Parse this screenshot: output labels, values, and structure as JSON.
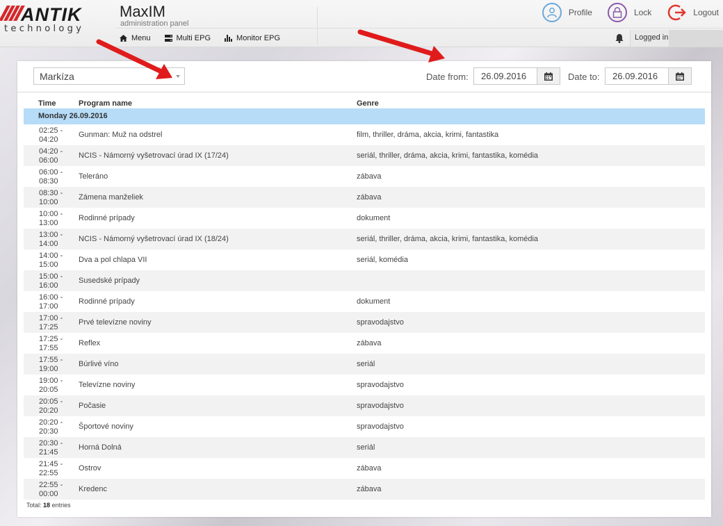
{
  "header": {
    "logo": {
      "brand": "ANTIK",
      "tagline": "technology"
    },
    "app_title": "MaxIM",
    "app_subtitle": "administration panel",
    "nav": [
      {
        "label": "Menu",
        "icon": "home-icon"
      },
      {
        "label": "Multi EPG",
        "icon": "server-icon"
      },
      {
        "label": "Monitor EPG",
        "icon": "bar-chart-icon"
      }
    ],
    "actions": {
      "profile": "Profile",
      "lock": "Lock",
      "logout": "Logout"
    },
    "logged_in_label": "Logged in:"
  },
  "filters": {
    "channel": "Markíza",
    "date_from_label": "Date from:",
    "date_from": "26.09.2016",
    "date_to_label": "Date to:",
    "date_to": "26.09.2016"
  },
  "table": {
    "columns": {
      "time": "Time",
      "name": "Program name",
      "genre": "Genre"
    },
    "group_label": "Monday 26.09.2016",
    "rows": [
      {
        "start": "02:25 -",
        "end": "04:20",
        "name": "Gunman: Muž na odstrel",
        "genre": "film, thriller, dráma, akcia, krimi, fantastika"
      },
      {
        "start": "04:20 -",
        "end": "06:00",
        "name": "NCIS - Námorný vyšetrovací úrad IX (17/24)",
        "genre": "seriál, thriller, dráma, akcia, krimi, fantastika, komédia"
      },
      {
        "start": "06:00 -",
        "end": "08:30",
        "name": "Teleráno",
        "genre": "zábava"
      },
      {
        "start": "08:30 -",
        "end": "10:00",
        "name": "Zámena manželiek",
        "genre": "zábava"
      },
      {
        "start": "10:00 -",
        "end": "13:00",
        "name": "Rodinné prípady",
        "genre": "dokument"
      },
      {
        "start": "13:00 -",
        "end": "14:00",
        "name": "NCIS - Námorný vyšetrovací úrad IX (18/24)",
        "genre": "seriál, thriller, dráma, akcia, krimi, fantastika, komédia"
      },
      {
        "start": "14:00 -",
        "end": "15:00",
        "name": "Dva a pol chlapa VII",
        "genre": "seriál, komédia"
      },
      {
        "start": "15:00 -",
        "end": "16:00",
        "name": "Susedské prípady",
        "genre": ""
      },
      {
        "start": "16:00 -",
        "end": "17:00",
        "name": "Rodinné prípady",
        "genre": "dokument"
      },
      {
        "start": "17:00 -",
        "end": "17:25",
        "name": "Prvé televízne noviny",
        "genre": "spravodajstvo"
      },
      {
        "start": "17:25 -",
        "end": "17:55",
        "name": "Reflex",
        "genre": "zábava"
      },
      {
        "start": "17:55 -",
        "end": "19:00",
        "name": "Búrlivé víno",
        "genre": "seriál"
      },
      {
        "start": "19:00 -",
        "end": "20:05",
        "name": "Televízne noviny",
        "genre": "spravodajstvo"
      },
      {
        "start": "20:05 -",
        "end": "20:20",
        "name": "Počasie",
        "genre": "spravodajstvo"
      },
      {
        "start": "20:20 -",
        "end": "20:30",
        "name": "Športové noviny",
        "genre": "spravodajstvo"
      },
      {
        "start": "20:30 -",
        "end": "21:45",
        "name": "Horná Dolná",
        "genre": "seriál"
      },
      {
        "start": "21:45 -",
        "end": "22:55",
        "name": "Ostrov",
        "genre": "zábava"
      },
      {
        "start": "22:55 -",
        "end": "00:00",
        "name": "Kredenc",
        "genre": "zábava"
      }
    ],
    "total_label": "Total:",
    "total_count": "18",
    "total_suffix": "entries"
  },
  "colors": {
    "accent_red": "#d6262b",
    "group_row": "#b6dcf8",
    "profile_icon": "#6aa7d8",
    "lock_icon": "#8a5aa8",
    "logout_icon": "#e0372f",
    "arrow": "#e01b1b"
  }
}
